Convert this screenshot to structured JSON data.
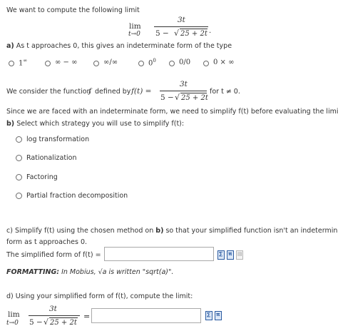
{
  "intro": {
    "text": "We want to compute the following limit",
    "limit_word": "lim",
    "limit_sub": "t→0",
    "numerator": "3t",
    "denominator_left": "5 − ",
    "denominator_radicand": "25 + 2t",
    "trailing": "."
  },
  "part_a": {
    "label": "a)",
    "text": "As t approaches 0, this gives an indeterminate form of the type",
    "options": [
      "1^∞",
      "∞ − ∞",
      "∞/∞",
      "0^0",
      "0/0",
      "0 × ∞"
    ],
    "option_display": [
      {
        "base": "1",
        "sup": "∞"
      },
      {
        "base": "∞ − ∞",
        "sup": ""
      },
      {
        "base": "∞/∞",
        "sup": ""
      },
      {
        "base": "0",
        "sup": "0"
      },
      {
        "base": "0/0",
        "sup": ""
      },
      {
        "base": "0 × ∞",
        "sup": ""
      }
    ]
  },
  "function_def": {
    "prefix": "We consider the function",
    "f": "f",
    "defined_by": "defined by",
    "lhs": "f(t) =",
    "numerator": "3t",
    "denominator_left": "5 − ",
    "denominator_radicand": "25 + 2t",
    "suffix": "for t ≠ 0."
  },
  "simplify_note": "Since we are faced with an indeterminate form, we need to simplify f(t) before evaluating the limit.",
  "part_b": {
    "label": "b)",
    "text": "Select which strategy you will use to simplify f(t):",
    "options": [
      "log transformation",
      "Rationalization",
      "Factoring",
      "Partial fraction decomposition"
    ]
  },
  "part_c": {
    "label": "c)",
    "line1_pre": "Simplify f(t) using the chosen method on",
    "line1_bold": "b)",
    "line1_post": "so that your simplified function isn't an indeterminate",
    "line2": "form as t approaches 0.",
    "answer_label": "The simplified form of f(t) =",
    "answer_value": "",
    "formatting_bold": "FORMATTING:",
    "formatting_text": "In Mobius, √a is written \"sqrt(a)\"."
  },
  "part_d": {
    "label": "d)",
    "text": "Using your simplified form of f(t), compute the limit:",
    "limit_word": "lim",
    "limit_sub": "t→0",
    "numerator": "3t",
    "denominator_left": "5 − ",
    "denominator_radicand": "25 + 2t",
    "equals": "=",
    "answer_value": ""
  },
  "toolbar_icons": [
    "equation-editor-icon",
    "math-palette-icon",
    "preview-icon"
  ],
  "colors": {
    "text": "#333333",
    "input_border": "#a9a9a9",
    "icon_blue": "#2a5aa0"
  }
}
